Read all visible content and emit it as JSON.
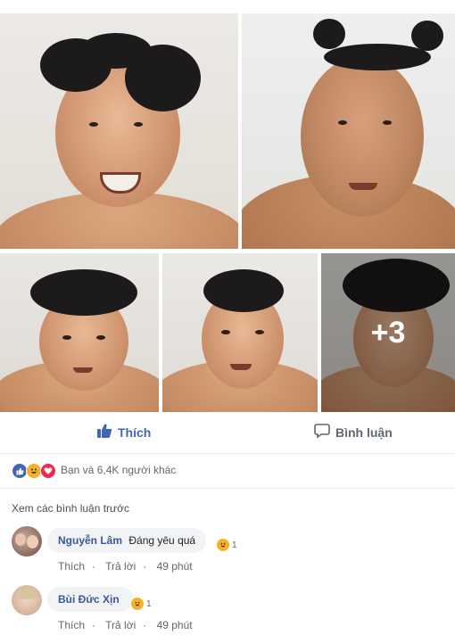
{
  "post": {
    "more_count": "+3"
  },
  "actions": {
    "like_label": "Thích",
    "comment_label": "Bình luận"
  },
  "reactions": {
    "summary": "Bạn và 6,4K người khác",
    "icons": [
      "like-icon",
      "haha-icon",
      "love-icon"
    ],
    "colors": {
      "like": "#4267b2",
      "haha": "#f7b125",
      "love": "#f0284a"
    }
  },
  "comments": {
    "view_previous": "Xem các bình luận trước",
    "items": [
      {
        "author": "Nguyễn Lâm",
        "text": "Đáng yêu quá",
        "reaction_count": "1",
        "like": "Thích",
        "reply": "Trả lời",
        "time": "49 phút"
      },
      {
        "author": "Bùi Đức Xịn",
        "text": "",
        "reaction_count": "1",
        "like": "Thích",
        "reply": "Trả lời",
        "time": "49 phút"
      }
    ]
  }
}
